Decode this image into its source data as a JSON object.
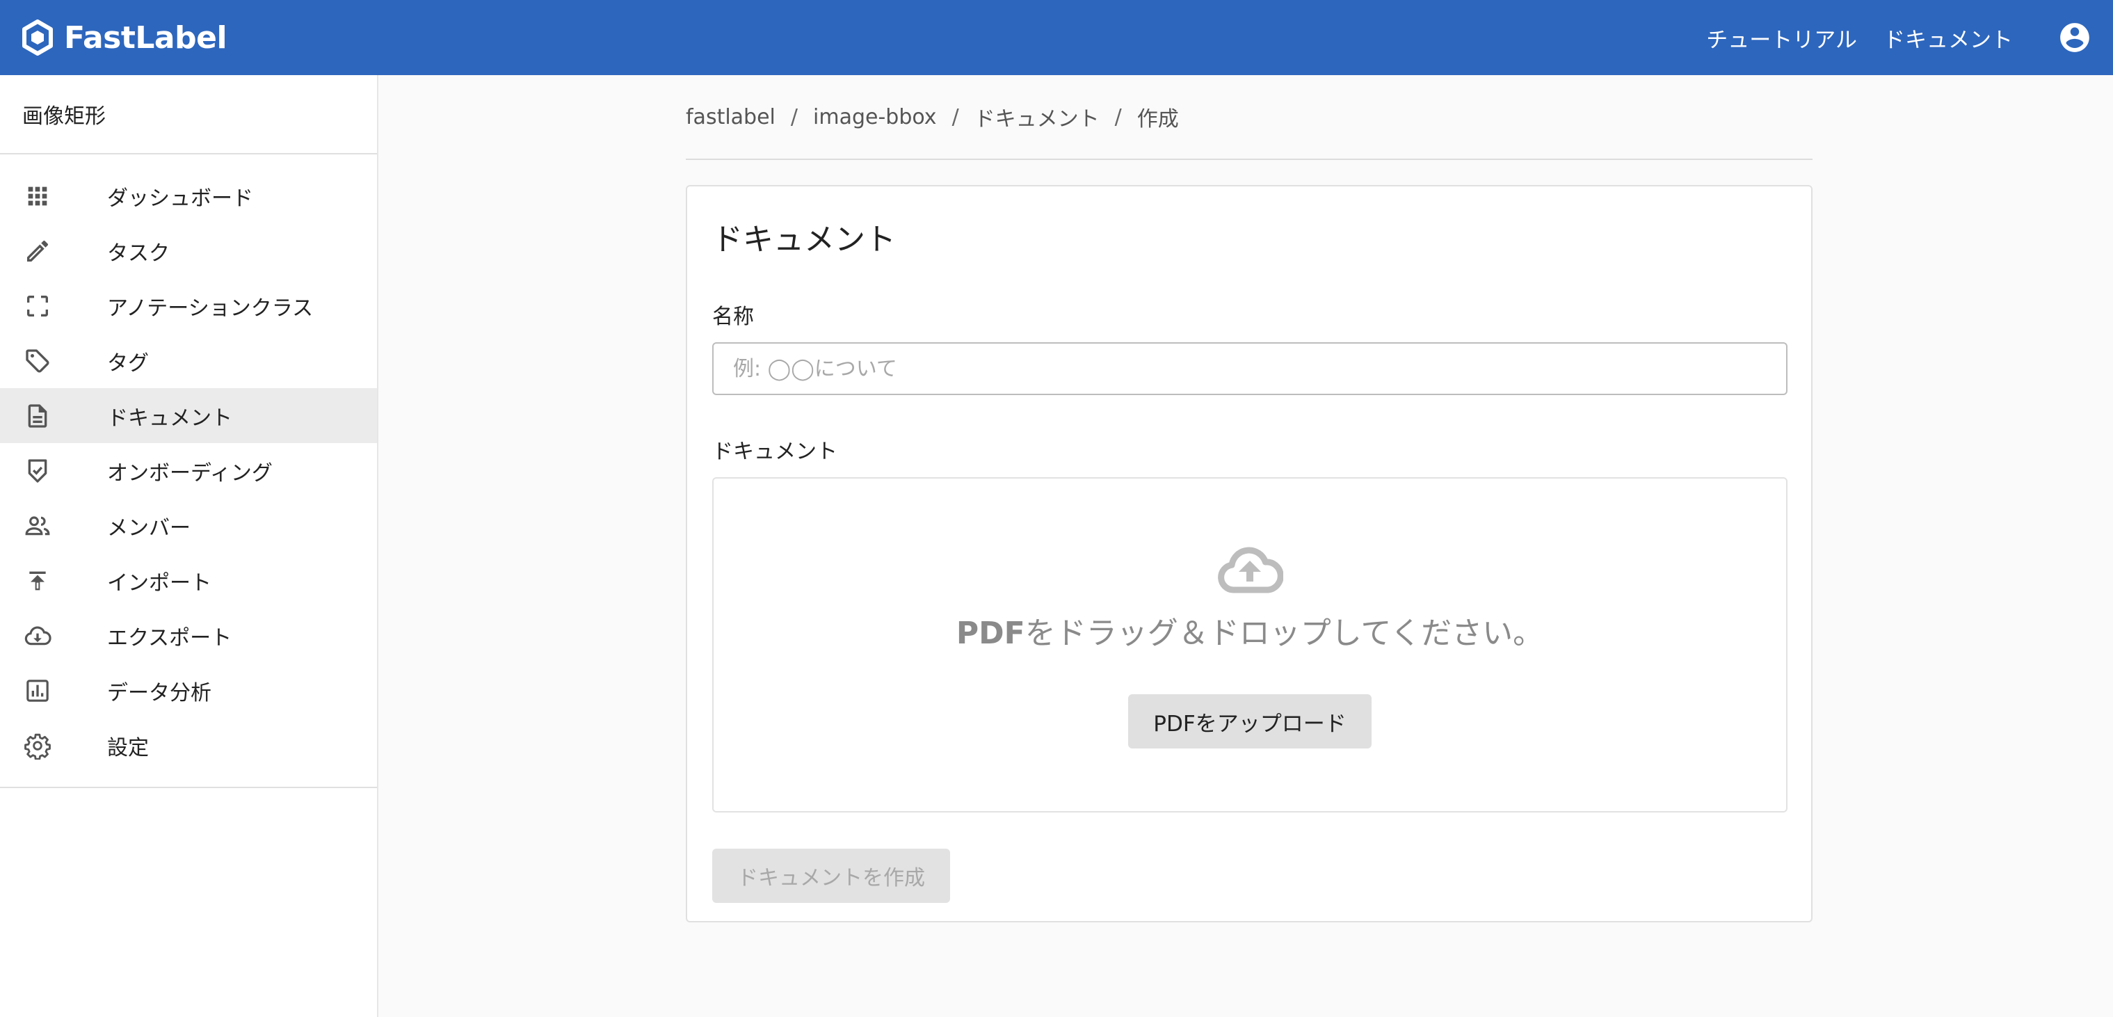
{
  "header": {
    "brand": "FastLabel",
    "nav": [
      {
        "label": "チュートリアル"
      },
      {
        "label": "ドキュメント"
      }
    ],
    "account_icon": "account-circle-icon"
  },
  "sidebar": {
    "project_title": "画像矩形",
    "items": [
      {
        "label": "ダッシュボード",
        "icon": "apps-grid-icon"
      },
      {
        "label": "タスク",
        "icon": "pencil-icon"
      },
      {
        "label": "アノテーションクラス",
        "icon": "crop-free-icon"
      },
      {
        "label": "タグ",
        "icon": "tag-icon"
      },
      {
        "label": "ドキュメント",
        "icon": "document-icon",
        "active": true
      },
      {
        "label": "オンボーディング",
        "icon": "shield-check-icon"
      },
      {
        "label": "メンバー",
        "icon": "people-icon"
      },
      {
        "label": "インポート",
        "icon": "upload-icon"
      },
      {
        "label": "エクスポート",
        "icon": "cloud-download-icon"
      },
      {
        "label": "データ分析",
        "icon": "bar-chart-icon"
      },
      {
        "label": "設定",
        "icon": "gear-icon"
      }
    ]
  },
  "breadcrumb": {
    "items": [
      "fastlabel",
      "image-bbox",
      "ドキュメント",
      "作成"
    ],
    "separator": "/"
  },
  "form": {
    "title": "ドキュメント",
    "name_label": "名称",
    "name_placeholder": "例: ◯◯について",
    "name_value": "",
    "document_label": "ドキュメント",
    "dropzone_text_bold": "PDF",
    "dropzone_text_rest": "をドラッグ＆ドロップしてください。",
    "upload_button": "PDFをアップロード",
    "create_button": "ドキュメントを作成"
  },
  "colors": {
    "header_bg": "#2d66bd",
    "active_item_bg": "#ebebeb"
  }
}
